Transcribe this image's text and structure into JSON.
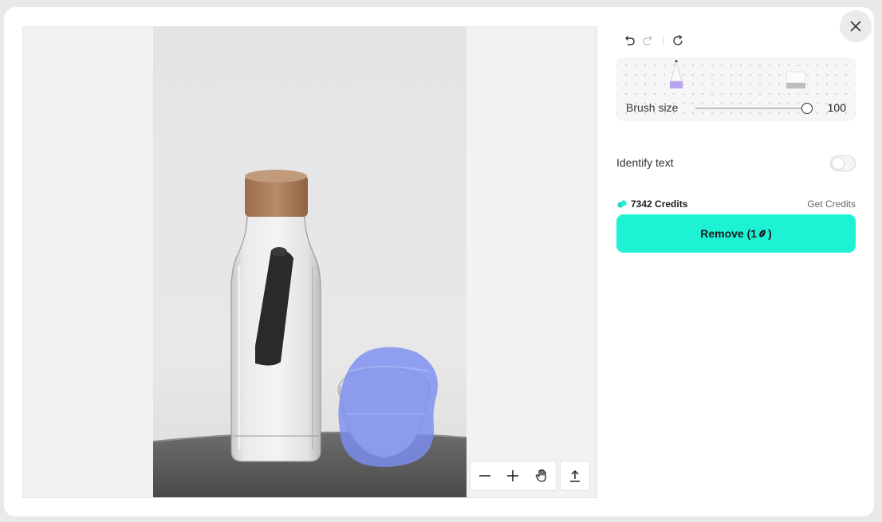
{
  "icons": {
    "close": "close-icon",
    "undo": "undo-icon",
    "redo": "redo-icon",
    "reset": "refresh-icon",
    "zoom_out": "minus-icon",
    "zoom_in": "plus-icon",
    "pan": "hand-icon",
    "export": "upload-icon",
    "credit": "bean-icon"
  },
  "brush": {
    "label": "Brush size",
    "value": "100",
    "level": 1.0
  },
  "identify_text": {
    "label": "Identify text",
    "enabled": false
  },
  "credits": {
    "amount_label": "7342 Credits",
    "get_label": "Get Credits"
  },
  "remove_button": {
    "prefix": "Remove (1",
    "suffix": ")"
  },
  "colors": {
    "accent": "#1ef2d4",
    "mask": "#7b8ef0",
    "brush_preview": "#b7a3f0"
  }
}
